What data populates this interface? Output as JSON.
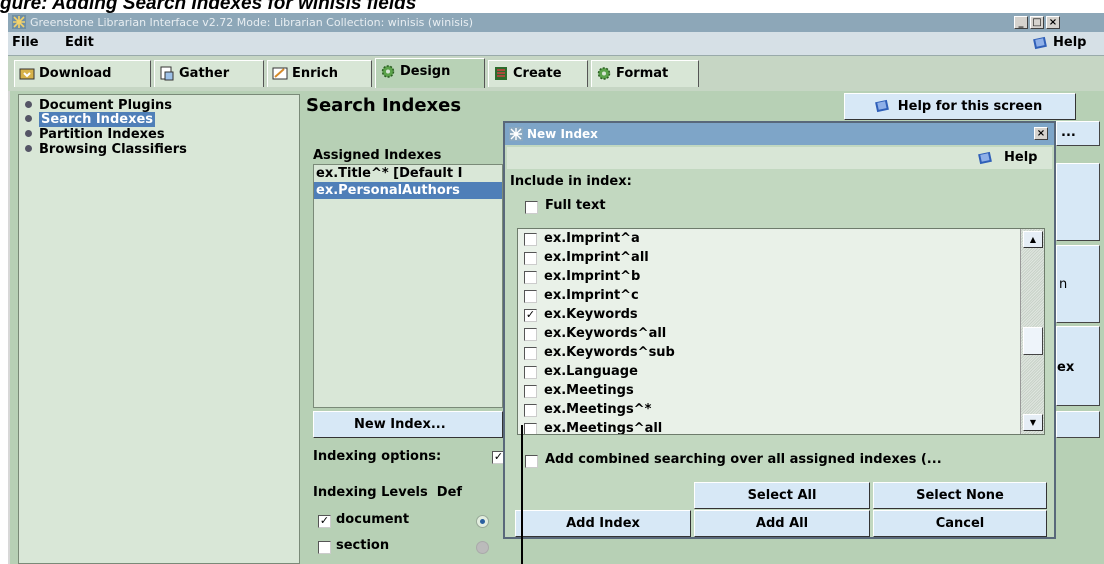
{
  "caption": "gure: Adding Search Indexes for winisis fields",
  "window": {
    "title": "Greenstone Librarian Interface v2.72  Mode: Librarian  Collection: winisis (winisis)",
    "controls": [
      "_",
      "□",
      "×"
    ]
  },
  "menu": {
    "file": "File",
    "edit": "Edit",
    "help": "Help"
  },
  "tabs": [
    {
      "label": "Download",
      "icon": "download-icon"
    },
    {
      "label": "Gather",
      "icon": "gather-icon"
    },
    {
      "label": "Enrich",
      "icon": "enrich-icon"
    },
    {
      "label": "Design",
      "icon": "gear-icon",
      "active": true
    },
    {
      "label": "Create",
      "icon": "create-icon"
    },
    {
      "label": "Format",
      "icon": "gear-icon"
    }
  ],
  "sidebar": {
    "items": [
      {
        "label": "Document Plugins"
      },
      {
        "label": "Search Indexes",
        "selected": true
      },
      {
        "label": "Partition Indexes"
      },
      {
        "label": "Browsing Classifiers"
      }
    ]
  },
  "main": {
    "title": "Search Indexes",
    "help_screen": "Help for this screen",
    "assigned_label": "Assigned Indexes",
    "assigned": [
      {
        "label": "ex.Title^* [Default I",
        "selected": false
      },
      {
        "label": "ex.PersonalAuthors",
        "selected": true
      }
    ],
    "new_index": "New Index...",
    "indexing_options": "Indexing options:",
    "indexing_levels": "Indexing Levels",
    "default_trunc": "Def",
    "levels": [
      {
        "label": "document",
        "checked": true,
        "default": true
      },
      {
        "label": "section",
        "checked": false,
        "default": false
      }
    ],
    "right_snippets": {
      "top": "...",
      "mid": "n",
      "low": "ex"
    }
  },
  "dialog": {
    "title": "New Index",
    "help": "Help",
    "include_label": "Include in index:",
    "full_text": "Full text",
    "fields": [
      {
        "label": "ex.Imprint^a",
        "checked": false
      },
      {
        "label": "ex.Imprint^all",
        "checked": false
      },
      {
        "label": "ex.Imprint^b",
        "checked": false
      },
      {
        "label": "ex.Imprint^c",
        "checked": false
      },
      {
        "label": "ex.Keywords",
        "checked": true
      },
      {
        "label": "ex.Keywords^all",
        "checked": false
      },
      {
        "label": "ex.Keywords^sub",
        "checked": false
      },
      {
        "label": "ex.Language",
        "checked": false
      },
      {
        "label": "ex.Meetings",
        "checked": false
      },
      {
        "label": "ex.Meetings^*",
        "checked": false
      },
      {
        "label": "ex.Meetings^all",
        "checked": false
      }
    ],
    "combined": "Add combined searching over all assigned indexes (...",
    "buttons": {
      "select_all": "Select All",
      "select_none": "Select None",
      "add_index": "Add Index",
      "add_all": "Add All",
      "cancel": "Cancel"
    }
  }
}
